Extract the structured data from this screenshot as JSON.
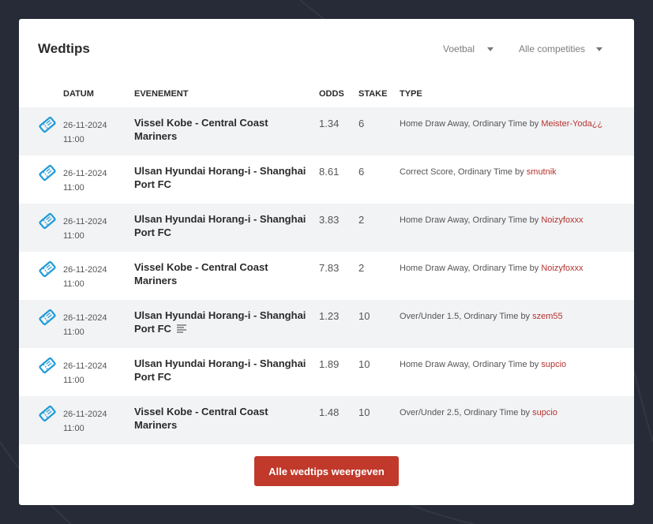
{
  "widget": {
    "title": "Wedtips",
    "sport_filter": "Voetbal",
    "competition_filter": "Alle competities"
  },
  "table": {
    "headers": {
      "date": "DATUM",
      "event": "EVENEMENT",
      "odds": "ODDS",
      "stake": "STAKE",
      "type": "TYPE"
    },
    "rows": [
      {
        "date": "26-11-2024",
        "time": "11:00",
        "event": "Vissel Kobe - Central Coast Mariners",
        "odds": "1.34",
        "stake": "6",
        "type": "Home Draw Away, Ordinary Time by",
        "user": "Meister-Yoda¿¿"
      },
      {
        "date": "26-11-2024",
        "time": "11:00",
        "event": "Ulsan Hyundai Horang-i - Shanghai Port FC",
        "odds": "8.61",
        "stake": "6",
        "type": "Correct Score, Ordinary Time by",
        "user": "smutnik"
      },
      {
        "date": "26-11-2024",
        "time": "11:00",
        "event": "Ulsan Hyundai Horang-i - Shanghai Port FC",
        "odds": "3.83",
        "stake": "2",
        "type": "Home Draw Away, Ordinary Time by",
        "user": "Noizyfoxxx"
      },
      {
        "date": "26-11-2024",
        "time": "11:00",
        "event": "Vissel Kobe - Central Coast Mariners",
        "odds": "7.83",
        "stake": "2",
        "type": "Home Draw Away, Ordinary Time by",
        "user": "Noizyfoxxx"
      },
      {
        "date": "26-11-2024",
        "time": "11:00",
        "event": "Ulsan Hyundai Horang-i - Shanghai Port FC",
        "odds": "1.23",
        "stake": "10",
        "type": "Over/Under 1.5, Ordinary Time by",
        "user": "szem55",
        "has_note": true
      },
      {
        "date": "26-11-2024",
        "time": "11:00",
        "event": "Ulsan Hyundai Horang-i - Shanghai Port FC",
        "odds": "1.89",
        "stake": "10",
        "type": "Home Draw Away, Ordinary Time by",
        "user": "supcio"
      },
      {
        "date": "26-11-2024",
        "time": "11:00",
        "event": "Vissel Kobe - Central Coast Mariners",
        "odds": "1.48",
        "stake": "10",
        "type": "Over/Under 2.5, Ordinary Time by",
        "user": "supcio"
      }
    ]
  },
  "footer": {
    "button_label": "Alle wedtips weergeven"
  },
  "icons": {
    "row_icon": "ticket-icon",
    "note_icon": "text-lines-icon"
  },
  "colors": {
    "background": "#272b37",
    "accent": "#c0392b",
    "link": "#b5322d",
    "ticket": "#1e9bd7",
    "row_alt": "#f2f3f5"
  }
}
